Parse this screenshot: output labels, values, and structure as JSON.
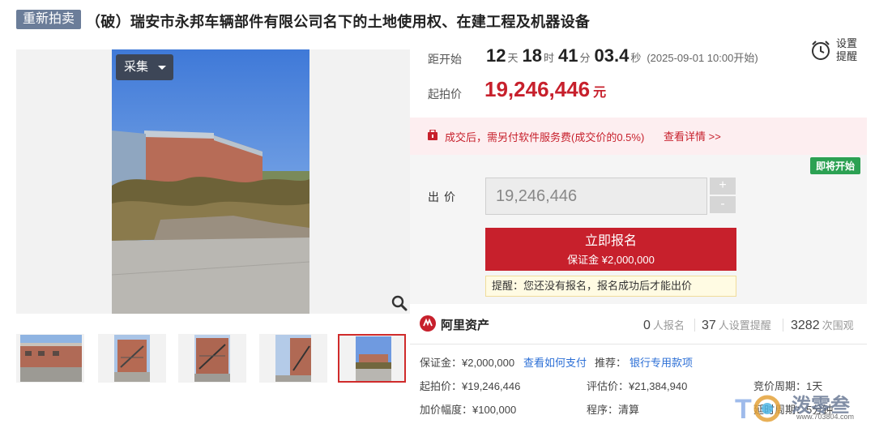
{
  "title": {
    "badge": "重新拍卖",
    "text": "（破）瑞安市永邦车辆部件有限公司名下的土地使用权、在建工程及机器设备"
  },
  "gallery": {
    "collect_label": "采集",
    "icons": {
      "dropdown": "chevron-down-icon",
      "zoom": "zoom-icon"
    },
    "thumbnail_count": 5,
    "active_thumbnail": 5
  },
  "timing": {
    "label": "距开始",
    "days": "12",
    "days_unit": "天",
    "hours": "18",
    "hours_unit": "时",
    "minutes": "41",
    "minutes_unit": "分",
    "seconds": "03.4",
    "seconds_unit": "秒",
    "start_time": "(2025-09-01 10:00开始)"
  },
  "reminder": {
    "label": "设置提醒",
    "icon": "alarm-clock-icon"
  },
  "start_price": {
    "label": "起拍价",
    "value": "19,246,446",
    "unit": "元"
  },
  "fee_notice": {
    "text": "成交后，需另付软件服务费(成交价的0.5%)",
    "link": "查看详情 >>",
    "icon": "fee-icon"
  },
  "bid": {
    "status_badge": "即将开始",
    "label": "出价",
    "input_value": "19,246,446",
    "plus": "+",
    "minus": "-",
    "signup_label": "立即报名",
    "deposit_line": "保证金 ¥2,000,000",
    "notice": "提醒：您还没有报名，报名成功后才能出价"
  },
  "stats": {
    "brand": "阿里资产",
    "brand_icon": "ali-logo-icon",
    "signups": "0",
    "signups_unit": "人报名",
    "reminders": "37",
    "reminders_unit": "人设置提醒",
    "views": "3282",
    "views_unit": "次围观"
  },
  "details": {
    "deposit": "保证金：¥2,000,000",
    "pay_link": "查看如何支付",
    "recommend": "推荐：",
    "bank_link": "银行专用款项",
    "start_price": "起拍价：¥19,246,446",
    "appraisal": "评估价：¥21,384,940",
    "cycle": "竞价周期：1天",
    "increment": "加价幅度：¥100,000",
    "procedure": "程序：清算",
    "extend": "延时周期：5分钟"
  },
  "watermark": {
    "text": "泼零叁",
    "url": "www.703804.com"
  },
  "colors": {
    "accent_red": "#c7202c",
    "badge_green": "#2ca153",
    "link_blue": "#2c6fd6",
    "badge_gray": "#6b7d99"
  }
}
